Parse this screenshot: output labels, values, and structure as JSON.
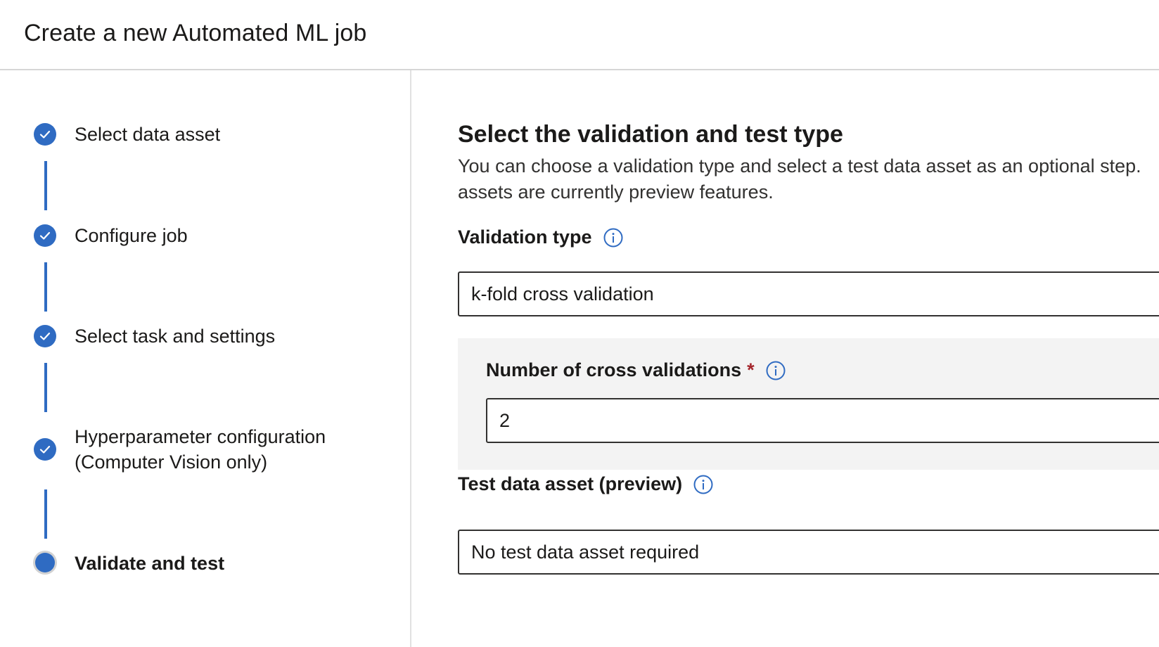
{
  "header": {
    "title": "Create a new Automated ML job"
  },
  "wizard": {
    "steps": [
      {
        "label": "Select data asset",
        "status": "completed"
      },
      {
        "label": "Configure job",
        "status": "completed"
      },
      {
        "label": "Select task and settings",
        "status": "completed"
      },
      {
        "label_line1": "Hyperparameter configuration",
        "label_line2": "(Computer Vision only)",
        "status": "completed"
      },
      {
        "label": "Validate and test",
        "status": "current"
      }
    ]
  },
  "main": {
    "section_title": "Select the validation and test type",
    "description_line1": "You can choose a validation type and select a test data asset as an optional step.",
    "description_line2": "assets are currently preview features.",
    "validation_type": {
      "label": "Validation type",
      "value": "k-fold cross validation"
    },
    "cross_validations": {
      "label": "Number of cross validations",
      "required_marker": "*",
      "value": "2"
    },
    "test_data_asset": {
      "label": "Test data asset (preview)",
      "value": "No test data asset required"
    }
  },
  "colors": {
    "accent": "#2f6bc2",
    "required": "#a4262c",
    "panel_bg": "#f3f3f3",
    "border": "#323130"
  }
}
